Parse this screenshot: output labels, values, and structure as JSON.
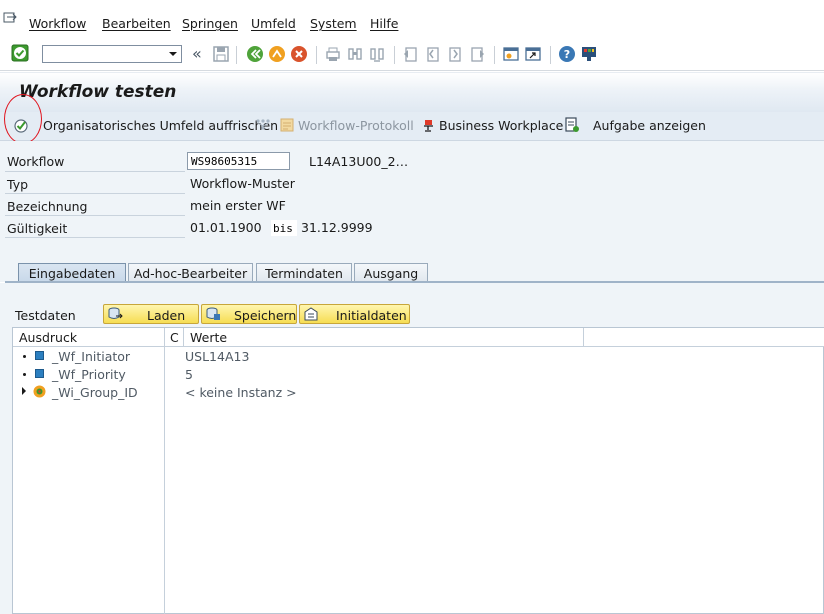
{
  "menubar": {
    "items": [
      "Workflow",
      "Bearbeiten",
      "Springen",
      "Umfeld",
      "System",
      "Hilfe"
    ]
  },
  "toolbar": {
    "command_value": "",
    "nav_back_glyph": "«"
  },
  "title": "Workflow testen",
  "app_toolbar": {
    "refresh_label": "Organisatorisches Umfeld auffrischen",
    "protocol_label": "Workflow-Protokoll",
    "workplace_label": "Business Workplace",
    "task_label": "Aufgabe anzeigen"
  },
  "form": {
    "workflow_label": "Workflow",
    "workflow_value": "WS98605315",
    "workflow_desc": "L14A13U00_2…",
    "typ_label": "Typ",
    "typ_value": "Workflow-Muster",
    "bez_label": "Bezeichnung",
    "bez_value": "mein erster WF",
    "gueltig_label": "Gültigkeit",
    "gueltig_from": "01.01.1900",
    "bis_label": "bis",
    "gueltig_to": "31.12.9999"
  },
  "tabs": [
    "Eingabedaten",
    "Ad-hoc-Bearbeiter",
    "Termindaten",
    "Ausgang"
  ],
  "testdaten": {
    "label": "Testdaten",
    "load": "Laden",
    "save": "Speichern",
    "initial": "Initialdaten"
  },
  "tree": {
    "headers": {
      "expr": "Ausdruck",
      "c": "C",
      "values": "Werte"
    },
    "rows": [
      {
        "name": "_Wf_Initiator",
        "value": "USL14A13"
      },
      {
        "name": "_Wf_Priority",
        "value": "5"
      },
      {
        "name": "_Wi_Group_ID",
        "value": "< keine Instanz >"
      }
    ]
  },
  "colors": {
    "accent_green": "#3c9a2e",
    "highlight_circle": "#e0141e",
    "button_yellow": "#f6dd53"
  }
}
